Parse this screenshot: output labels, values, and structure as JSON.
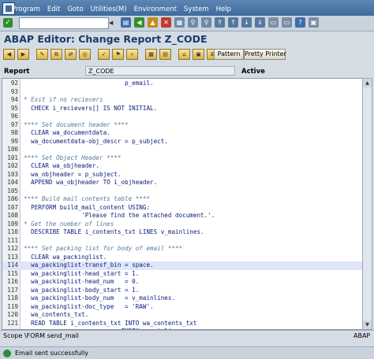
{
  "menu": {
    "items": [
      "Program",
      "Edit",
      "Goto",
      "Utilities(M)",
      "Environment",
      "System",
      "Help"
    ]
  },
  "window": {
    "title": "ABAP Editor: Change Report Z_CODE"
  },
  "toolbar": {
    "pattern_label": "Pattern",
    "pretty_printer_label": "Pretty Printer"
  },
  "header": {
    "report_label": "Report",
    "report_value": "Z_CODE",
    "status": "Active"
  },
  "editor": {
    "lines": [
      {
        "num": "92",
        "text": "                            p_email.",
        "type": "code"
      },
      {
        "num": "93",
        "text": "",
        "type": "code"
      },
      {
        "num": "94",
        "text": "* Exit if no recievers",
        "type": "comment"
      },
      {
        "num": "95",
        "text": "  CHECK i_recievers[] IS NOT INITIAL.",
        "type": "code"
      },
      {
        "num": "96",
        "text": "",
        "type": "code"
      },
      {
        "num": "97",
        "text": "**** Set document header ****",
        "type": "comment"
      },
      {
        "num": "98",
        "text": "  CLEAR wa_documentdata.",
        "type": "code"
      },
      {
        "num": "99",
        "text": "  wa_documentdata-obj_descr = p_subject.",
        "type": "code"
      },
      {
        "num": "100",
        "text": "",
        "type": "code"
      },
      {
        "num": "101",
        "text": "**** Set Object Header ****",
        "type": "comment"
      },
      {
        "num": "102",
        "text": "  CLEAR wa_objheader.",
        "type": "code"
      },
      {
        "num": "103",
        "text": "  wa_objheader = p_subject.",
        "type": "code"
      },
      {
        "num": "104",
        "text": "  APPEND wa_objheader TO i_objheader.",
        "type": "code"
      },
      {
        "num": "105",
        "text": "",
        "type": "code"
      },
      {
        "num": "106",
        "text": "**** Build mail contents table ****",
        "type": "comment"
      },
      {
        "num": "107",
        "text": "  PERFORM build_mail_content USING:",
        "type": "code"
      },
      {
        "num": "108",
        "text": "                'Please find the attached document.'.",
        "type": "code"
      },
      {
        "num": "109",
        "text": "* Get the number of lines",
        "type": "comment"
      },
      {
        "num": "110",
        "text": "  DESCRIBE TABLE i_contents_txt LINES v_mainlines.",
        "type": "code"
      },
      {
        "num": "111",
        "text": "",
        "type": "code"
      },
      {
        "num": "112",
        "text": "**** Set packing list for body of email ****",
        "type": "comment"
      },
      {
        "num": "113",
        "text": "  CLEAR wa_packinglist.",
        "type": "code"
      },
      {
        "num": "114",
        "text": "  wa_packinglist-transf_bin = space.",
        "type": "code",
        "highlight": true
      },
      {
        "num": "115",
        "text": "  wa_packinglist-head_start = 1.",
        "type": "code"
      },
      {
        "num": "116",
        "text": "  wa_packinglist-head_num   = 0.",
        "type": "code"
      },
      {
        "num": "117",
        "text": "  wa_packinglist-body_start = 1.",
        "type": "code"
      },
      {
        "num": "118",
        "text": "  wa_packinglist-body_num   = v_mainlines.",
        "type": "code"
      },
      {
        "num": "119",
        "text": "  wa_packinglist-doc_type   = 'RAW'.",
        "type": "code"
      },
      {
        "num": "120",
        "text": "  wa_contents_txt.",
        "type": "code"
      },
      {
        "num": "121",
        "text": "  READ TABLE i_contents_txt INTO wa_contents_txt",
        "type": "code"
      },
      {
        "num": "",
        "text": "                           INDEX v_mainlines.",
        "type": "code"
      }
    ]
  },
  "scope": {
    "text": "Scope \\FORM send_mail",
    "language": "ABAP"
  },
  "statusbar": {
    "message": "Email sent successfully"
  },
  "colors": {
    "menubar": "#3f6b9c",
    "title": "#163d6a",
    "keyword": "#0a1a7a",
    "comment": "#5a7a9c",
    "success": "#2e8b3a"
  }
}
